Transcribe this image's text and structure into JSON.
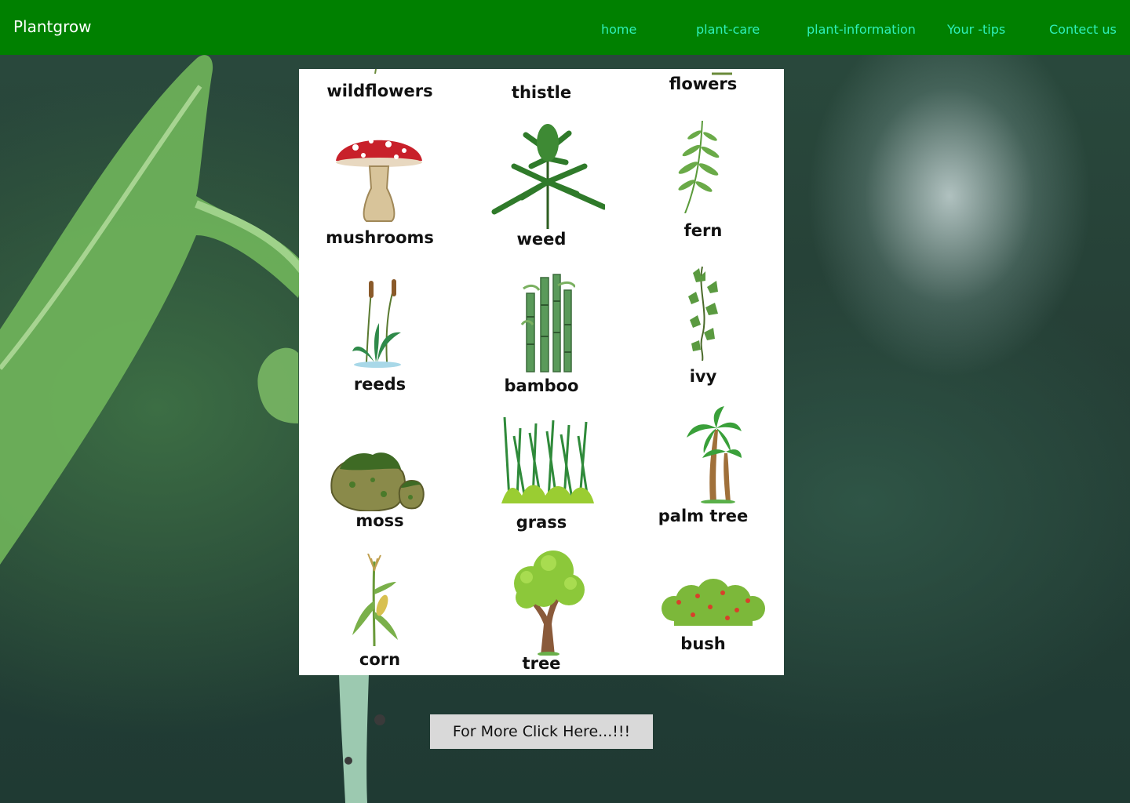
{
  "header": {
    "brand": "Plantgrow",
    "nav": [
      {
        "label": "home"
      },
      {
        "label": "plant-care"
      },
      {
        "label": "plant-information"
      },
      {
        "label": "Your -tips"
      },
      {
        "label": "Contect us"
      }
    ]
  },
  "gallery": {
    "items": [
      {
        "label": "wildflowers",
        "icon": "wildflowers-icon"
      },
      {
        "label": "thistle",
        "icon": "thistle-icon"
      },
      {
        "label": "flowers",
        "icon": "flowers-icon"
      },
      {
        "label": "mushrooms",
        "icon": "mushroom-icon"
      },
      {
        "label": "weed",
        "icon": "weed-icon"
      },
      {
        "label": "fern",
        "icon": "fern-icon"
      },
      {
        "label": "reeds",
        "icon": "reeds-icon"
      },
      {
        "label": "bamboo",
        "icon": "bamboo-icon"
      },
      {
        "label": "ivy",
        "icon": "ivy-icon"
      },
      {
        "label": "moss",
        "icon": "moss-icon"
      },
      {
        "label": "grass",
        "icon": "grass-icon"
      },
      {
        "label": "palm tree",
        "icon": "palm-tree-icon"
      },
      {
        "label": "corn",
        "icon": "corn-icon"
      },
      {
        "label": "tree",
        "icon": "tree-icon"
      },
      {
        "label": "bush",
        "icon": "bush-icon"
      }
    ]
  },
  "cta": {
    "label": "For More Click Here...!!!"
  },
  "colors": {
    "header_bg": "#008000",
    "nav_link": "#2ef0b8",
    "button_bg": "#d9d9d9"
  }
}
